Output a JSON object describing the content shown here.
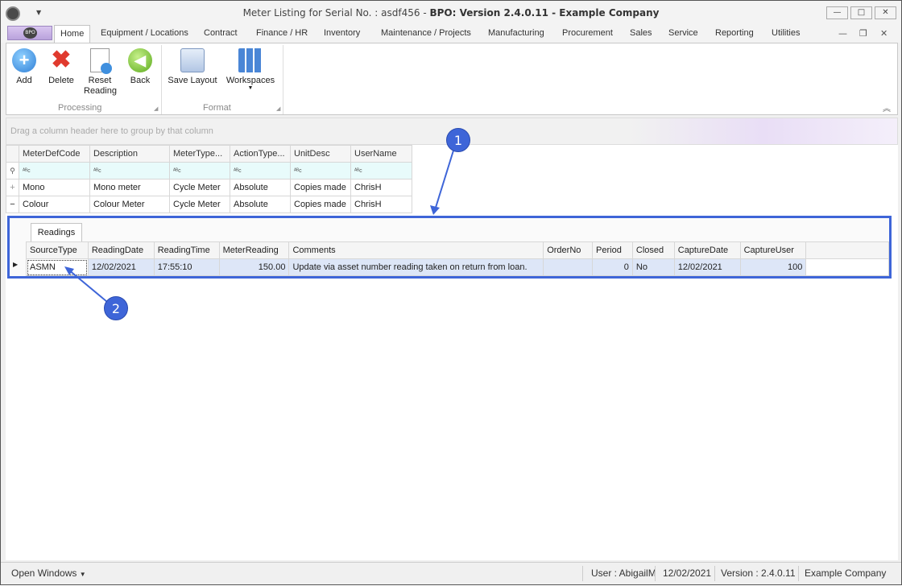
{
  "window": {
    "title": "Meter Listing for Serial No. : asdf456",
    "title_suffix": "BPO: Version 2.4.0.11 - Example Company",
    "logo_text": "BPO"
  },
  "ribbon_tabs": [
    "Home",
    "Equipment / Locations",
    "Contract",
    "Finance / HR",
    "Inventory",
    "Maintenance / Projects",
    "Manufacturing",
    "Procurement",
    "Sales",
    "Service",
    "Reporting",
    "Utilities"
  ],
  "ribbon": {
    "processing": {
      "label": "Processing",
      "buttons": {
        "add": "Add",
        "delete": "Delete",
        "reset": "Reset Reading",
        "back": "Back"
      }
    },
    "format": {
      "label": "Format",
      "buttons": {
        "save_layout": "Save Layout",
        "workspaces": "Workspaces"
      }
    }
  },
  "group_panel_hint": "Drag a column header here to group by that column",
  "meter_grid": {
    "columns": [
      "MeterDefCode",
      "Description",
      "MeterType...",
      "ActionType...",
      "UnitDesc",
      "UserName"
    ],
    "filter_glyph": "ᴬᴮc",
    "rows": [
      {
        "expander": "+",
        "code": "Mono",
        "description": "Mono meter",
        "meter_type": "Cycle Meter",
        "action_type": "Absolute",
        "unit_desc": "Copies made",
        "user_name": "ChrisH"
      },
      {
        "expander": "−",
        "code": "Colour",
        "description": "Colour Meter",
        "meter_type": "Cycle Meter",
        "action_type": "Absolute",
        "unit_desc": "Copies made",
        "user_name": "ChrisH"
      }
    ]
  },
  "readings": {
    "tab_label": "Readings",
    "columns": [
      "SourceType",
      "ReadingDate",
      "ReadingTime",
      "MeterReading",
      "Comments",
      "OrderNo",
      "Period",
      "Closed",
      "CaptureDate",
      "CaptureUser"
    ],
    "rows": [
      {
        "source_type": "ASMN",
        "reading_date": "12/02/2021",
        "reading_time": "17:55:10",
        "meter_reading": "150.00",
        "comments": "Update via asset number reading taken on return from loan.",
        "order_no": "",
        "period": "0",
        "closed": "No",
        "capture_date": "12/02/2021",
        "capture_user": "100"
      }
    ]
  },
  "callouts": {
    "one": "1",
    "two": "2"
  },
  "status": {
    "open_windows": "Open Windows",
    "user": "User : AbigailM",
    "date": "12/02/2021",
    "version": "Version : 2.4.0.11",
    "company": "Example Company"
  },
  "colors": {
    "accent": "#3e65d8",
    "file_tab": "#c8b2e6"
  }
}
